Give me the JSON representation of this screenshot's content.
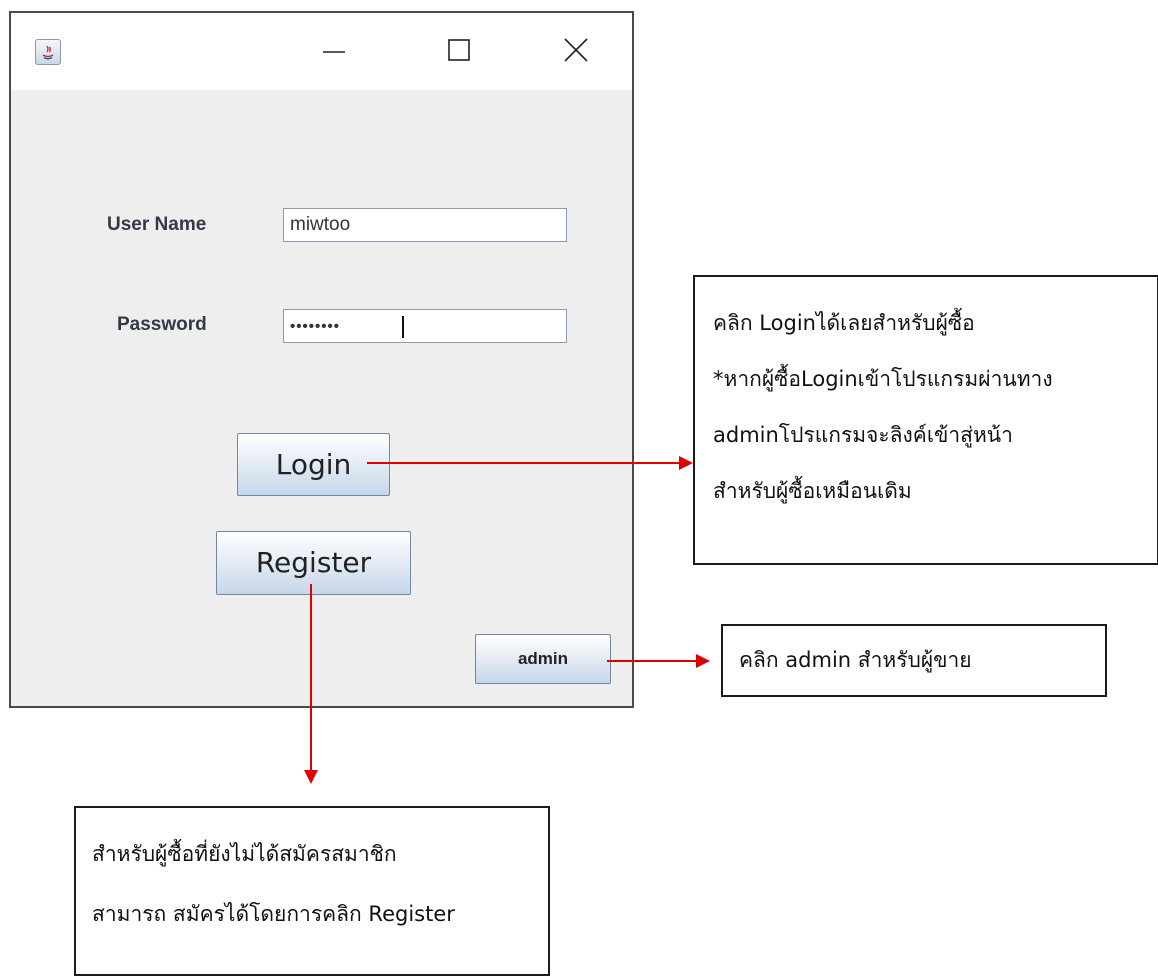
{
  "window": {
    "icon": "java-icon",
    "controls": [
      "minimize-icon",
      "maximize-icon",
      "close-icon"
    ]
  },
  "form": {
    "username_label": "User Name",
    "username_value": "miwtoo",
    "password_label": "Password",
    "password_value": "••••••••"
  },
  "buttons": {
    "login": "Login",
    "register": "Register",
    "admin": "admin"
  },
  "annotations": {
    "login_note": [
      "คลิก Loginได้เลยสำหรับผู้ซื้อ",
      "*หากผู้ซื้อLoginเข้าโปรแกรมผ่านทาง",
      "adminโปรแกรมจะลิงค์เข้าสู่หน้า",
      "สำหรับผู้ซื้อเหมือนเดิม"
    ],
    "admin_note": [
      "คลิก admin สำหรับผู้ขาย"
    ],
    "register_note": [
      "สำหรับผู้ซื้อที่ยังไม่ได้สมัครสมาชิก",
      "สามารถ สมัครได้โดยการคลิก Register"
    ]
  },
  "colors": {
    "arrow": "#e00000",
    "window_bg": "#eeeeee",
    "button_gradient_end": "#c6d6ea"
  }
}
